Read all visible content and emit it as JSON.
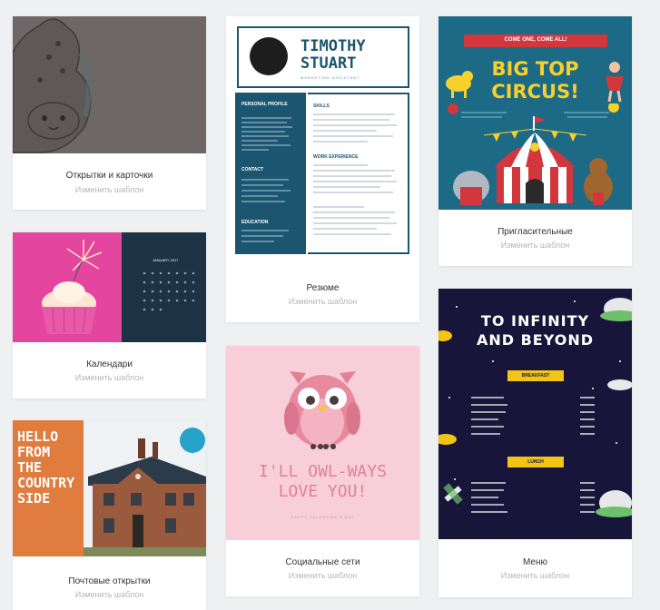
{
  "templates": [
    {
      "id": "cards",
      "label": "Открытки и карточки",
      "action": "Изменить шаблон"
    },
    {
      "id": "resume",
      "label": "Резюме",
      "action": "Изменить шаблон",
      "preview": {
        "name_line1": "TIMOTHY",
        "name_line2": "STUART",
        "subtitle": "MARKETING ASSISTANT",
        "left_headings": [
          "PERSONAL PROFILE",
          "CONTACT",
          "EDUCATION"
        ],
        "right_headings": [
          "SKILLS",
          "WORK EXPERIENCE"
        ]
      }
    },
    {
      "id": "invitations",
      "label": "Пригласительные",
      "action": "Изменить шаблон",
      "preview": {
        "banner": "COME ONE, COME ALL!",
        "title_line1": "BIG TOP",
        "title_line2": "CIRCUS!"
      }
    },
    {
      "id": "calendars",
      "label": "Календари",
      "action": "Изменить шаблон",
      "preview": {
        "month": "JANUARY 2017"
      }
    },
    {
      "id": "social",
      "label": "Социальные сети",
      "action": "Изменить шаблон",
      "preview": {
        "line1": "I'LL OWL-WAYS",
        "line2": "LOVE YOU!",
        "footer": "HAPPY VALENTINE'S DAY"
      }
    },
    {
      "id": "menu",
      "label": "Меню",
      "action": "Изменить шаблон",
      "preview": {
        "title_line1": "TO INFINITY",
        "title_line2": "AND BEYOND",
        "badge1": "BREAKFAST",
        "badge2": "LUNCH"
      }
    },
    {
      "id": "postcards",
      "label": "Почтовые открытки",
      "action": "Изменить шаблон",
      "preview": {
        "lines": [
          "HELLO",
          "FROM",
          "THE",
          "COUNTRY",
          "SIDE"
        ]
      }
    }
  ],
  "colors": {
    "background": "#eef0f2",
    "resume_accent": "#1c5570",
    "circus_bg": "#1d6a86",
    "circus_yellow": "#f7d02a",
    "menu_bg": "#17163a",
    "calendar_pink": "#e4469f",
    "postcard_orange": "#df7c3e",
    "owl_pink": "#f8cfd9"
  }
}
